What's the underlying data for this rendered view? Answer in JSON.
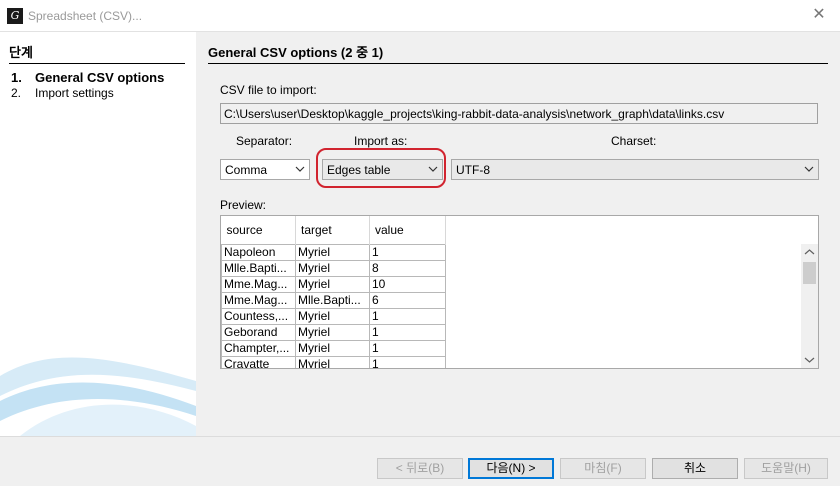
{
  "window": {
    "title": "Spreadsheet (CSV)...",
    "icon": "gephi-icon"
  },
  "steps": {
    "heading": "단계",
    "items": [
      {
        "num": "1.",
        "label": "General CSV options"
      },
      {
        "num": "2.",
        "label": "Import settings"
      }
    ]
  },
  "main": {
    "title": "General CSV options (2 중 1)",
    "file_label": "CSV file to import:",
    "file_path": "C:\\Users\\user\\Desktop\\kaggle_projects\\king-rabbit-data-analysis\\network_graph\\data\\links.csv",
    "separator_label": "Separator:",
    "separator_value": "Comma",
    "import_as_label": "Import as:",
    "import_as_value": "Edges table",
    "charset_label": "Charset:",
    "charset_value": "UTF-8",
    "preview_label": "Preview:",
    "highlight_color": "#d1242f"
  },
  "preview": {
    "headers": [
      "source",
      "target",
      "value"
    ],
    "rows": [
      [
        "Napoleon",
        "Myriel",
        "1"
      ],
      [
        "Mlle.Bapti...",
        "Myriel",
        "8"
      ],
      [
        "Mme.Mag...",
        "Myriel",
        "10"
      ],
      [
        "Mme.Mag...",
        "Mlle.Bapti...",
        "6"
      ],
      [
        "Countess,...",
        "Myriel",
        "1"
      ],
      [
        "Geborand",
        "Myriel",
        "1"
      ],
      [
        "Champter,...",
        "Myriel",
        "1"
      ],
      [
        "Cravatte",
        "Myriel",
        "1"
      ]
    ]
  },
  "buttons": {
    "back": "< 뒤로(B)",
    "next": "다음(N) >",
    "finish": "마침(F)",
    "cancel": "취소",
    "help": "도움말(H)"
  }
}
